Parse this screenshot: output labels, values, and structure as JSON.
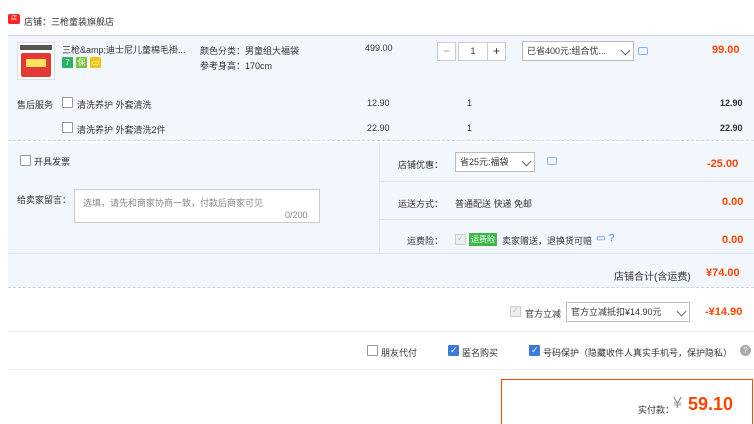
{
  "shop": {
    "icon": "store-icon",
    "label": "店铺：三枪童装旗舰店"
  },
  "item": {
    "title": "三枪&amp;迪士尼儿童棉毛褂...",
    "color_label": "颜色分类：男童组大福袋",
    "size_label": "参考身高：170cm",
    "unit_price": "499.00",
    "quantity": "1",
    "minus": "−",
    "plus": "+",
    "promo_select": "已省400元:组合优...",
    "total": "99.00"
  },
  "after_sales": {
    "label": "售后服务",
    "options": [
      {
        "name": "清洗养护 外套清洗",
        "price": "12.90",
        "qty": "1",
        "total": "12.90"
      },
      {
        "name": "清洗养护 外套清洗2件",
        "price": "22.90",
        "qty": "1",
        "total": "22.90"
      }
    ]
  },
  "invoice": {
    "label": "开具发票"
  },
  "shop_discount": {
    "label": "店铺优惠：",
    "select": "省25元:福袋",
    "amount": "-25.00"
  },
  "message": {
    "label": "给卖家留言：",
    "placeholder": "选填，请先和商家协商一致，付款后商家可见",
    "counter": "0/200"
  },
  "shipping": {
    "label": "运送方式：",
    "value": "普通配送 快递 免邮",
    "amount": "0.00"
  },
  "insurance": {
    "label": "运费险：",
    "tag": "运费险",
    "desc": "卖家赠送，退换货可赔",
    "amount": "0.00"
  },
  "shop_total": {
    "label": "店铺合计(含运费)",
    "amount": "¥74.00"
  },
  "official": {
    "label": "官方立减",
    "select": "官方立减抵扣¥14.90元",
    "amount": "-¥14.90"
  },
  "options": {
    "friend_pay": "朋友代付",
    "anonymous": "匿名购买",
    "number_protect": "号码保护（隐藏收件人真实手机号，保护隐私）"
  },
  "payment": {
    "label": "实付款：",
    "currency": "¥",
    "amount": "59.10"
  },
  "colors": {
    "accent": "#ff4400",
    "blue_bg": "#f2f6fd",
    "checkbox": "#3a7bdc"
  }
}
